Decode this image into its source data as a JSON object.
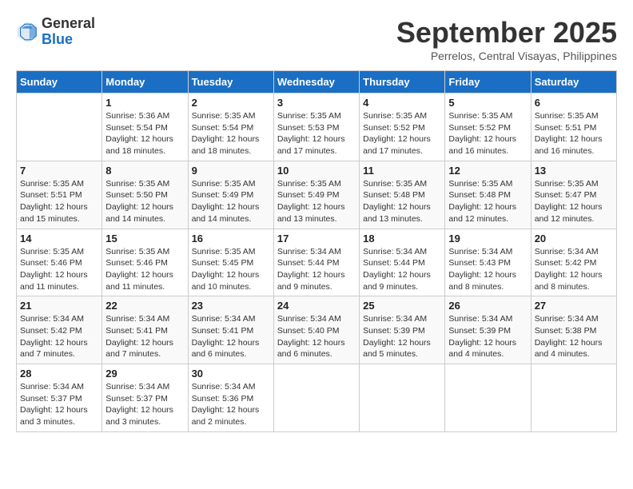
{
  "header": {
    "logo_general": "General",
    "logo_blue": "Blue",
    "month": "September 2025",
    "location": "Perrelos, Central Visayas, Philippines"
  },
  "days_of_week": [
    "Sunday",
    "Monday",
    "Tuesday",
    "Wednesday",
    "Thursday",
    "Friday",
    "Saturday"
  ],
  "weeks": [
    [
      {
        "day": "",
        "info": ""
      },
      {
        "day": "1",
        "info": "Sunrise: 5:36 AM\nSunset: 5:54 PM\nDaylight: 12 hours\nand 18 minutes."
      },
      {
        "day": "2",
        "info": "Sunrise: 5:35 AM\nSunset: 5:54 PM\nDaylight: 12 hours\nand 18 minutes."
      },
      {
        "day": "3",
        "info": "Sunrise: 5:35 AM\nSunset: 5:53 PM\nDaylight: 12 hours\nand 17 minutes."
      },
      {
        "day": "4",
        "info": "Sunrise: 5:35 AM\nSunset: 5:52 PM\nDaylight: 12 hours\nand 17 minutes."
      },
      {
        "day": "5",
        "info": "Sunrise: 5:35 AM\nSunset: 5:52 PM\nDaylight: 12 hours\nand 16 minutes."
      },
      {
        "day": "6",
        "info": "Sunrise: 5:35 AM\nSunset: 5:51 PM\nDaylight: 12 hours\nand 16 minutes."
      }
    ],
    [
      {
        "day": "7",
        "info": "Sunrise: 5:35 AM\nSunset: 5:51 PM\nDaylight: 12 hours\nand 15 minutes."
      },
      {
        "day": "8",
        "info": "Sunrise: 5:35 AM\nSunset: 5:50 PM\nDaylight: 12 hours\nand 14 minutes."
      },
      {
        "day": "9",
        "info": "Sunrise: 5:35 AM\nSunset: 5:49 PM\nDaylight: 12 hours\nand 14 minutes."
      },
      {
        "day": "10",
        "info": "Sunrise: 5:35 AM\nSunset: 5:49 PM\nDaylight: 12 hours\nand 13 minutes."
      },
      {
        "day": "11",
        "info": "Sunrise: 5:35 AM\nSunset: 5:48 PM\nDaylight: 12 hours\nand 13 minutes."
      },
      {
        "day": "12",
        "info": "Sunrise: 5:35 AM\nSunset: 5:48 PM\nDaylight: 12 hours\nand 12 minutes."
      },
      {
        "day": "13",
        "info": "Sunrise: 5:35 AM\nSunset: 5:47 PM\nDaylight: 12 hours\nand 12 minutes."
      }
    ],
    [
      {
        "day": "14",
        "info": "Sunrise: 5:35 AM\nSunset: 5:46 PM\nDaylight: 12 hours\nand 11 minutes."
      },
      {
        "day": "15",
        "info": "Sunrise: 5:35 AM\nSunset: 5:46 PM\nDaylight: 12 hours\nand 11 minutes."
      },
      {
        "day": "16",
        "info": "Sunrise: 5:35 AM\nSunset: 5:45 PM\nDaylight: 12 hours\nand 10 minutes."
      },
      {
        "day": "17",
        "info": "Sunrise: 5:34 AM\nSunset: 5:44 PM\nDaylight: 12 hours\nand 9 minutes."
      },
      {
        "day": "18",
        "info": "Sunrise: 5:34 AM\nSunset: 5:44 PM\nDaylight: 12 hours\nand 9 minutes."
      },
      {
        "day": "19",
        "info": "Sunrise: 5:34 AM\nSunset: 5:43 PM\nDaylight: 12 hours\nand 8 minutes."
      },
      {
        "day": "20",
        "info": "Sunrise: 5:34 AM\nSunset: 5:42 PM\nDaylight: 12 hours\nand 8 minutes."
      }
    ],
    [
      {
        "day": "21",
        "info": "Sunrise: 5:34 AM\nSunset: 5:42 PM\nDaylight: 12 hours\nand 7 minutes."
      },
      {
        "day": "22",
        "info": "Sunrise: 5:34 AM\nSunset: 5:41 PM\nDaylight: 12 hours\nand 7 minutes."
      },
      {
        "day": "23",
        "info": "Sunrise: 5:34 AM\nSunset: 5:41 PM\nDaylight: 12 hours\nand 6 minutes."
      },
      {
        "day": "24",
        "info": "Sunrise: 5:34 AM\nSunset: 5:40 PM\nDaylight: 12 hours\nand 6 minutes."
      },
      {
        "day": "25",
        "info": "Sunrise: 5:34 AM\nSunset: 5:39 PM\nDaylight: 12 hours\nand 5 minutes."
      },
      {
        "day": "26",
        "info": "Sunrise: 5:34 AM\nSunset: 5:39 PM\nDaylight: 12 hours\nand 4 minutes."
      },
      {
        "day": "27",
        "info": "Sunrise: 5:34 AM\nSunset: 5:38 PM\nDaylight: 12 hours\nand 4 minutes."
      }
    ],
    [
      {
        "day": "28",
        "info": "Sunrise: 5:34 AM\nSunset: 5:37 PM\nDaylight: 12 hours\nand 3 minutes."
      },
      {
        "day": "29",
        "info": "Sunrise: 5:34 AM\nSunset: 5:37 PM\nDaylight: 12 hours\nand 3 minutes."
      },
      {
        "day": "30",
        "info": "Sunrise: 5:34 AM\nSunset: 5:36 PM\nDaylight: 12 hours\nand 2 minutes."
      },
      {
        "day": "",
        "info": ""
      },
      {
        "day": "",
        "info": ""
      },
      {
        "day": "",
        "info": ""
      },
      {
        "day": "",
        "info": ""
      }
    ]
  ]
}
